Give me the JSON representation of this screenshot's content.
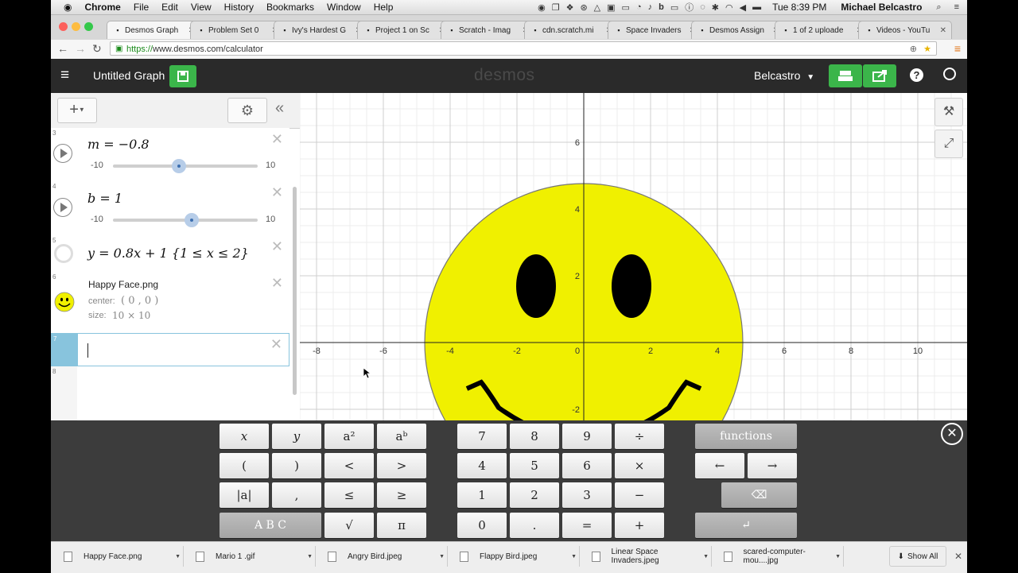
{
  "menubar": {
    "apple": "",
    "items": [
      "Chrome",
      "File",
      "Edit",
      "View",
      "History",
      "Bookmarks",
      "Window",
      "Help"
    ],
    "clock": "Tue 8:39 PM",
    "user": "Michael Belcastro"
  },
  "tabs": [
    {
      "label": "Desmos Graph",
      "active": true
    },
    {
      "label": "Problem Set 0"
    },
    {
      "label": "Ivy's Hardest G"
    },
    {
      "label": "Project 1 on Sc"
    },
    {
      "label": "Scratch - Imag"
    },
    {
      "label": "cdn.scratch.mi"
    },
    {
      "label": "Space Invaders"
    },
    {
      "label": "Desmos Assign"
    },
    {
      "label": "1 of 2 uploade"
    },
    {
      "label": "Videos - YouTu"
    }
  ],
  "address": {
    "scheme": "https://",
    "rest": "www.desmos.com/calculator"
  },
  "header": {
    "title": "Untitled Graph",
    "logo": "desmos",
    "user": "Belcastro"
  },
  "expressions": [
    {
      "num": "3",
      "latex": "m = −0.8",
      "min": "-10",
      "max": "10",
      "value": -0.8
    },
    {
      "num": "4",
      "latex": "b = 1",
      "min": "-10",
      "max": "10",
      "value": 1
    },
    {
      "num": "5",
      "latex": "y = 0.8x + 1 {1 ≤ x ≤ 2}"
    },
    {
      "num": "6",
      "name": "Happy Face.png",
      "center_label": "center:",
      "center_value": "( 0 , 0 )",
      "size_label": "size:",
      "size_value": "10 × 10"
    },
    {
      "num": "7"
    },
    {
      "num": "8"
    }
  ],
  "graph": {
    "x_ticks": [
      "-8",
      "-6",
      "-4",
      "-2",
      "0",
      "2",
      "4",
      "6",
      "8",
      "10"
    ],
    "y_ticks": [
      "6",
      "4",
      "2",
      "-2"
    ]
  },
  "keypad": {
    "left": [
      "x",
      "y",
      "a²",
      "aᵇ",
      "(",
      ")",
      "<",
      ">",
      "|a|",
      ",",
      "≤",
      "≥",
      "A B C",
      "√",
      "π"
    ],
    "numbers": [
      "7",
      "8",
      "9",
      "÷",
      "4",
      "5",
      "6",
      "×",
      "1",
      "2",
      "3",
      "−",
      "0",
      ".",
      "=",
      "+"
    ],
    "functions_label": "functions",
    "left_arrow": "←",
    "right_arrow": "→",
    "backspace": "⌫",
    "enter": "↵"
  },
  "downloads": {
    "items": [
      "Happy Face.png",
      "Mario 1 .gif",
      "Angry Bird.jpeg",
      "Flappy Bird.jpeg",
      "Linear Space Invaders.jpeg",
      "scared-computer-mou....jpg"
    ],
    "show_all": "Show All"
  },
  "colors": {
    "desmos_green": "#3bb54a",
    "header_bg": "#2a2a2a",
    "face_yellow": "#f0f000",
    "active_row": "#88c4dd"
  }
}
